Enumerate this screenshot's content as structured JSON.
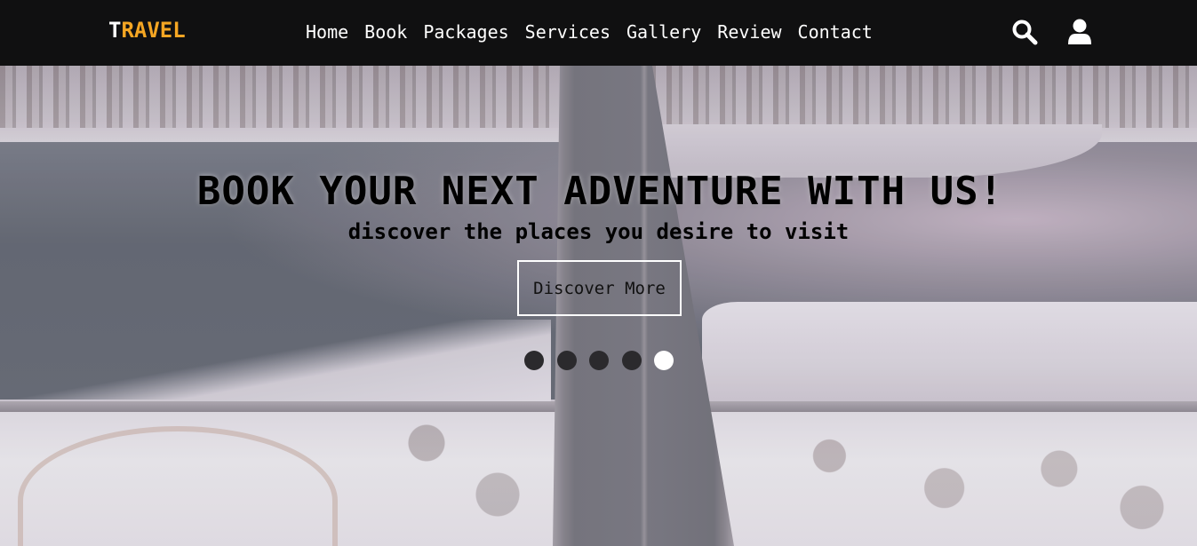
{
  "header": {
    "logo_first": "T",
    "logo_rest": "RAVEL",
    "nav": [
      "Home",
      "Book",
      "Packages",
      "Services",
      "Gallery",
      "Review",
      "Contact"
    ],
    "icons": [
      "search-icon",
      "user-icon"
    ]
  },
  "hero": {
    "headline": "BOOK YOUR NEXT ADVENTURE WITH US!",
    "subline": "discover the places you desire to visit",
    "cta_label": "Discover More",
    "slides_count": 5,
    "active_slide": 5
  },
  "colors": {
    "header_bg": "#000000",
    "logo_accent": "#f5a623",
    "nav_text": "#ffffff",
    "dot_inactive": "#2b2a2d",
    "dot_active": "#ffffff"
  }
}
